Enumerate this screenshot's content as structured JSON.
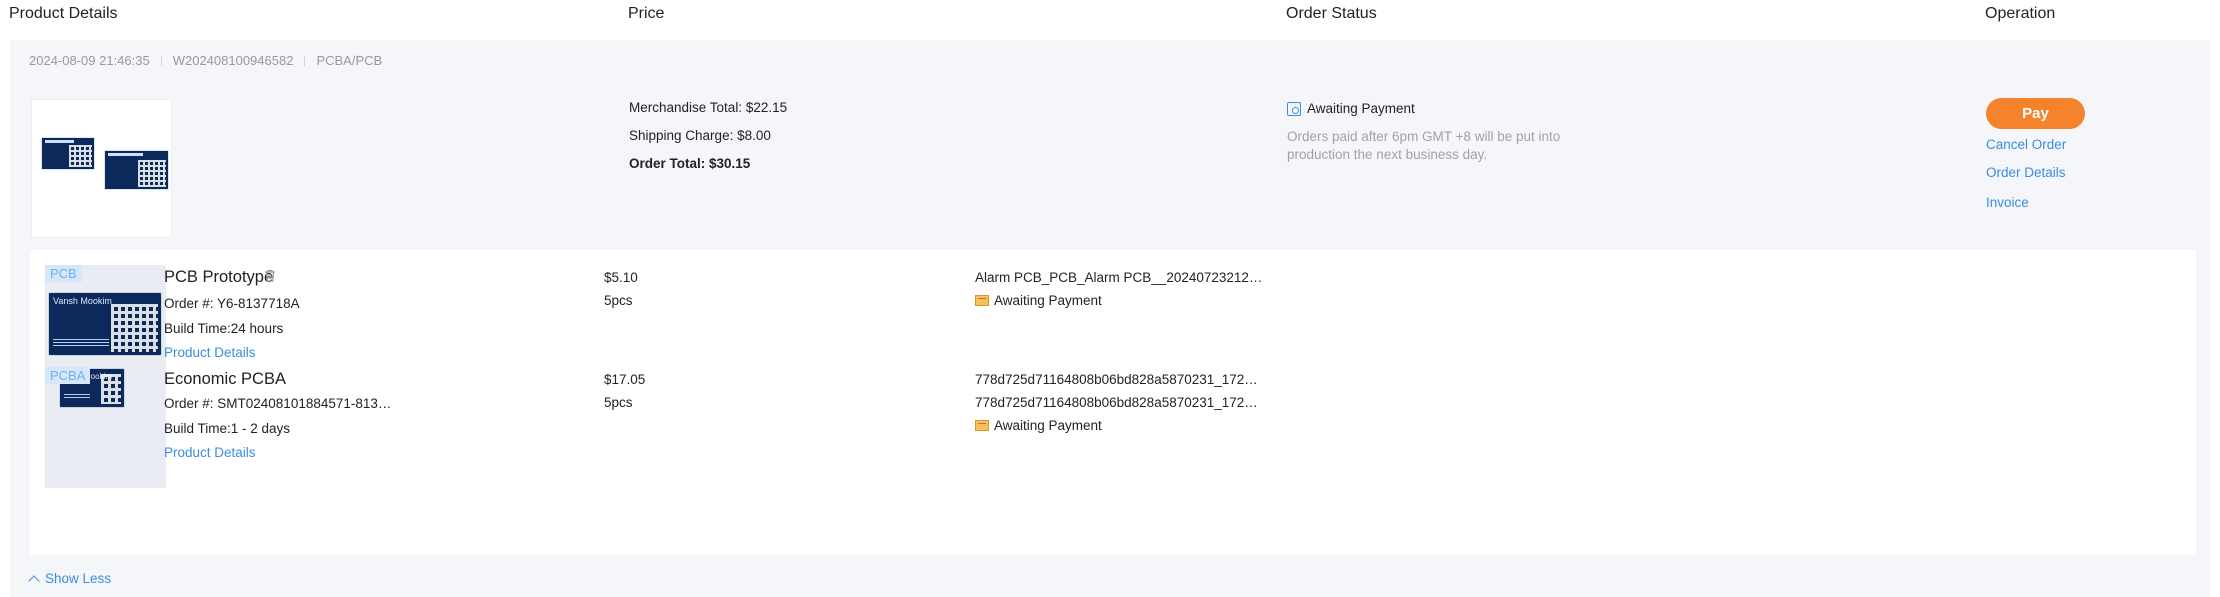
{
  "header": {
    "product_details": "Product Details",
    "price": "Price",
    "order_status": "Order Status",
    "operation": "Operation"
  },
  "order": {
    "date": "2024-08-09 21:46:35",
    "number": "W202408100946582",
    "category": "PCBA/PCB",
    "merchandise_total": "Merchandise Total: $22.15",
    "shipping_charge": "Shipping Charge: $8.00",
    "order_total": "Order Total: $30.15",
    "status": "Awaiting Payment",
    "status_note": "Orders paid after 6pm GMT +8 will be put into production the next business day.",
    "operations": {
      "pay": "Pay",
      "cancel": "Cancel Order",
      "details": "Order Details",
      "invoice": "Invoice"
    }
  },
  "items": [
    {
      "tag": "PCB",
      "board_text": "Vansh Mookim",
      "name": "PCB Prototype",
      "order_no": "Order #: Y6-8137718A",
      "build_time": "Build Time:24 hours",
      "link": "Product Details",
      "price": "$5.10",
      "qty": "5pcs",
      "file1": "Alarm PCB_PCB_Alarm PCB__20240723212…",
      "status": "Awaiting Payment"
    },
    {
      "tag": "PCBA",
      "board_text": "Mookim",
      "name": "Economic PCBA",
      "order_no": "Order #: SMT02408101884571-813…",
      "build_time": "Build Time:1 - 2 days",
      "link": "Product Details",
      "price": "$17.05",
      "qty": "5pcs",
      "file1": "778d725d71164808b06bd828a5870231_172…",
      "file2": "778d725d71164808b06bd828a5870231_172…",
      "status": "Awaiting Payment"
    }
  ],
  "show_less": "Show Less",
  "icons": {
    "status": "search-document-icon",
    "item_status": "envelope-icon",
    "delete": "trash-icon",
    "collapse": "chevron-up-icon"
  },
  "colors": {
    "accent": "#3a8de0",
    "pay_button": "#f5832b",
    "board": "#0b2a5b"
  }
}
